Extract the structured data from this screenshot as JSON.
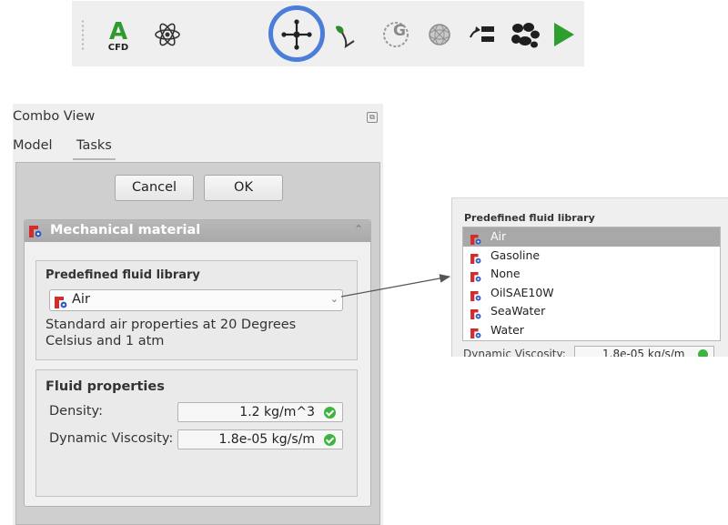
{
  "toolbar": {
    "icons": [
      {
        "name": "cfd-workbench-icon",
        "label": "CFD",
        "letter": "A"
      },
      {
        "name": "atom-physics-icon"
      },
      {
        "name": "mesh-nodes-icon",
        "highlighted": true
      },
      {
        "name": "plant-sprout-icon"
      },
      {
        "name": "gmsh-icon",
        "letter": "G"
      },
      {
        "name": "sphere-mesh-icon"
      },
      {
        "name": "boundary-condition-icon"
      },
      {
        "name": "pebbles-icon"
      },
      {
        "name": "run-solver-icon"
      }
    ],
    "highlight_color": "#4a7ed9"
  },
  "combo_view": {
    "title": "Combo View",
    "tabs": [
      {
        "label": "Model",
        "active": false
      },
      {
        "label": "Tasks",
        "active": true
      }
    ],
    "buttons": {
      "cancel_label": "Cancel",
      "ok_label": "OK"
    },
    "panel": {
      "title": "Mechanical material",
      "library_group_label": "Predefined fluid library",
      "selected_fluid": "Air",
      "description": "Standard air properties at 20 Degrees Celsius and 1 atm",
      "properties_title": "Fluid properties",
      "properties": [
        {
          "label": "Density:",
          "value": "1.2  kg/m^3"
        },
        {
          "label": "Dynamic Viscosity:",
          "value": "1.8e-05 kg/s/m"
        }
      ]
    }
  },
  "dropdown": {
    "label": "Predefined fluid library",
    "items": [
      "Air",
      "Gasoline",
      "None",
      "OilSAE10W",
      "SeaWater",
      "Water"
    ],
    "selected_index": 0,
    "cut_row": {
      "label": "Dynamic Viscosity:",
      "value": "1.8e-05 kg/s/m"
    }
  },
  "colors": {
    "check": "#3fb33f",
    "selected_row": "#a8a8a8",
    "header_bar": "#b0b0b0",
    "run_green": "#2e9e2e"
  }
}
